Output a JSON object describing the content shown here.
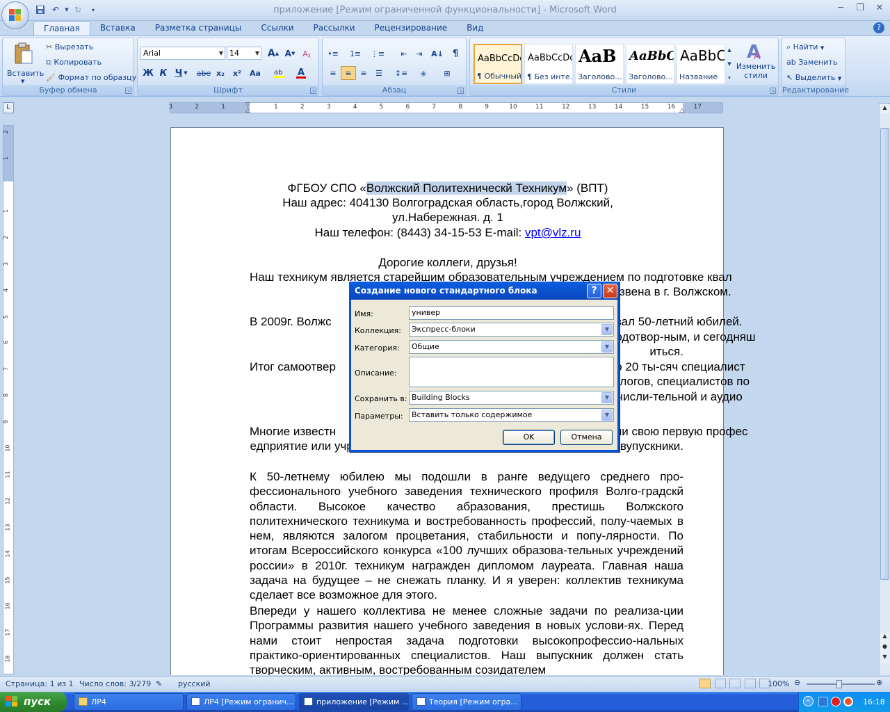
{
  "window": {
    "title": "приложение [Режим ограниченной функциональности] - Microsoft Word"
  },
  "ribbon": {
    "tabs": [
      "Главная",
      "Вставка",
      "Разметка страницы",
      "Ссылки",
      "Рассылки",
      "Рецензирование",
      "Вид"
    ],
    "active_tab": "Главная",
    "clipboard": {
      "paste": "Вставить",
      "cut": "Вырезать",
      "copy": "Копировать",
      "format_painter": "Формат по образцу",
      "title": "Буфер обмена"
    },
    "font": {
      "name": "Arial",
      "size": "14",
      "bold": "Ж",
      "italic": "К",
      "underline": "Ч",
      "strike": "abe",
      "subscript": "x₂",
      "superscript": "x²",
      "change_case": "Aa",
      "title": "Шрифт"
    },
    "paragraph": {
      "title": "Абзац"
    },
    "styles": {
      "items": [
        {
          "preview": "AaBbCcDc",
          "label": "¶ Обычный"
        },
        {
          "preview": "AaBbCcDc",
          "label": "¶ Без инте..."
        },
        {
          "preview": "AaB",
          "label": "Заголово..."
        },
        {
          "preview": "AaBbC",
          "label": "Заголово..."
        },
        {
          "preview": "AaBbC",
          "label": "Название"
        }
      ],
      "change_styles": "Изменить стили",
      "title": "Стили"
    },
    "editing": {
      "find": "Найти",
      "replace": "Заменить",
      "select": "Выделить",
      "title": "Редактирование"
    }
  },
  "ruler": {
    "ticks": [
      "3",
      "2",
      "1",
      "1",
      "2",
      "3",
      "4",
      "5",
      "6",
      "7",
      "8",
      "9",
      "10",
      "11",
      "12",
      "13",
      "14",
      "15",
      "16",
      "17"
    ],
    "vticks": [
      "2",
      "1",
      "1",
      "2",
      "3",
      "4",
      "5",
      "6",
      "7",
      "8",
      "9",
      "10",
      "11",
      "12",
      "13",
      "14",
      "15",
      "16",
      "17",
      "18",
      "19"
    ]
  },
  "document": {
    "header": {
      "line1_pre": "ФГБОУ СПО «",
      "line1_hl": "Волжский Политехническй Техникум",
      "line1_post": "» (ВПТ)",
      "line2": "Наш адрес: 404130 Волгоградская область,город Волжский,",
      "line3": "ул.Набережная. д. 1",
      "line4_pre": "Наш телефон: (8443) 34-15-53 E-mail: ",
      "line4_email": "vpt@vlz.ru"
    },
    "greeting": "Дорогие коллеги, друзья!",
    "paragraphs": [
      "Наш техникум является старейшим образовательным учреждением по подготовке квал",
      "звена в г. Волжском.",
      "В 2009г. Волжс",
      "новал 50-летний юбилей.",
      "плодотвор-ным, и сегодняш",
      "иться.",
      "Итог самоотвер",
      "оло 20 ты-сяч специалист",
      "экологов, специалистов по",
      "вычисли-тельной и аудио",
      "Многие известн",
      "чили свою первую профес",
      "едприятие или учреждение г. Волжского, где бы не работали наши вупускники.",
      "К 50-летнему юбилею мы подошли в ранге ведущего среднего про-фессионального учебного заведения технического профиля Волго-градскй области. Высокое качество абразования, престишь Волжского политехнического техникума и востребованность профессий, полу-чаемых в нем, являются залогом процветания, стабильности и попу-лярности. По итогам Всероссийского конкурса «100 лучших образова-тельных учреждений россии» в 2010г. техникум награжден дипломом лауреата. Главная наша задача на будущее – не снежать планку. И я уверен: коллектив техникума сделает все возможное для этого.",
      "Впереди у нашего коллектива не менее сложные задачи по реализа-ции Программы развития нашего учебного заведения в новых услови-ях. Перед нами стоит непростая задача подготовки высокопрофессио-нальных практико-ориентированных специалистов. Наш выпускник должен стать творческим, активным, востребованным созидателем"
    ]
  },
  "dialog": {
    "title": "Создание нового стандартного блока",
    "fields": [
      {
        "label": "Имя:",
        "value": "универ"
      },
      {
        "label": "Коллекция:",
        "value": "Экспресс-блоки"
      },
      {
        "label": "Категория:",
        "value": "Общие"
      },
      {
        "label": "Описание:",
        "value": ""
      },
      {
        "label": "Сохранить в:",
        "value": "Building Blocks"
      },
      {
        "label": "Параметры:",
        "value": "Вставить только содержимое"
      }
    ],
    "ok": "OK",
    "cancel": "Отмена"
  },
  "statusbar": {
    "page": "Страница: 1 из 1",
    "words": "Число слов: 3/279",
    "language": "русский",
    "zoom": "100%"
  },
  "taskbar": {
    "start": "пуск",
    "tasks": [
      {
        "label": "ЛР4",
        "type": "folder"
      },
      {
        "label": "ЛР4 [Режим огранич...",
        "type": "doc"
      },
      {
        "label": "приложение [Режим ...",
        "type": "doc",
        "active": true
      },
      {
        "label": "Теория [Режим огра...",
        "type": "doc"
      }
    ],
    "lang": "RU",
    "clock": "16:18"
  }
}
